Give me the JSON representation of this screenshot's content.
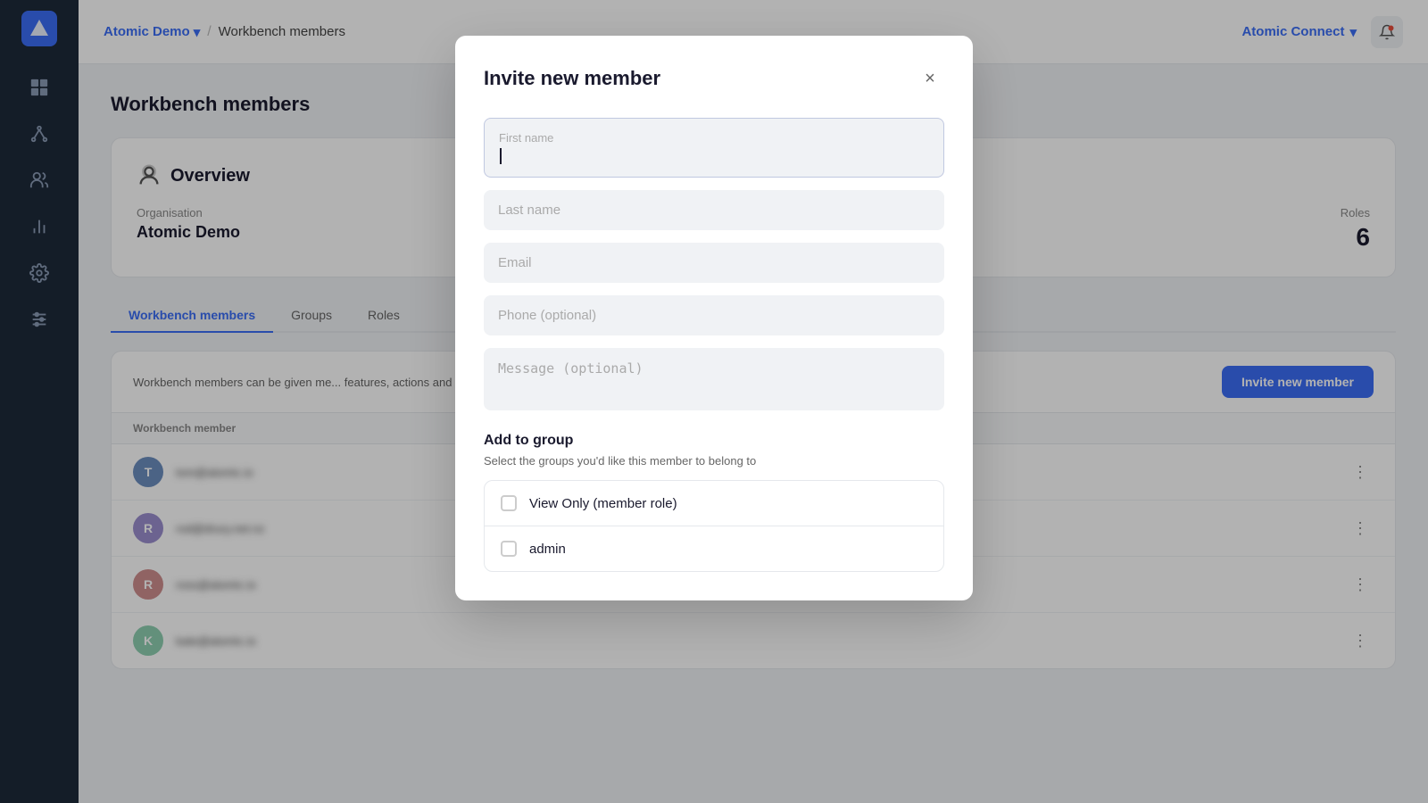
{
  "app": {
    "logo_letter": "A",
    "name": "Atomic Demo",
    "chevron": "▾",
    "breadcrumb_separator": "/",
    "page": "Workbench members",
    "connect": "Atomic Connect",
    "connect_chevron": "▾"
  },
  "sidebar": {
    "icons": [
      {
        "name": "layout-icon",
        "symbol": "▦"
      },
      {
        "name": "graph-icon",
        "symbol": "⑂"
      },
      {
        "name": "users-icon",
        "symbol": "👥"
      },
      {
        "name": "chart-icon",
        "symbol": "📊"
      },
      {
        "name": "settings-icon",
        "symbol": "⚙"
      },
      {
        "name": "sliders-icon",
        "symbol": "⚡"
      }
    ]
  },
  "page_title": "Workbench members",
  "overview": {
    "title": "Overview",
    "org_label": "Organisation",
    "org_value": "Atomic Demo",
    "roles_label": "Roles",
    "roles_value": "6"
  },
  "tabs": [
    {
      "label": "Workbench members",
      "active": true
    },
    {
      "label": "Groups",
      "active": false
    },
    {
      "label": "Roles",
      "active": false
    }
  ],
  "members": {
    "description": "Workbench members can be given me... features, actions and environments.",
    "description_full": "Workbench members can be given member access to specific features, actions and environments.",
    "invite_btn": "Invite new member",
    "col_header": "Workbench member",
    "rows": [
      {
        "initial": "T",
        "color": "#6c8ebf",
        "email": "tom@atomic.io"
      },
      {
        "initial": "R",
        "color": "#9b8ecf",
        "email": "rod@drury.net.nz"
      },
      {
        "initial": "R",
        "color": "#cf8e8e",
        "email": "ross@atomic.io"
      },
      {
        "initial": "K",
        "color": "#8ecfb0",
        "email": "kate@atomic.io"
      }
    ]
  },
  "modal": {
    "title": "Invite new member",
    "close_label": "×",
    "fields": {
      "first_name_placeholder": "First name",
      "last_name_placeholder": "Last name",
      "email_placeholder": "Email",
      "phone_placeholder": "Phone (optional)",
      "message_placeholder": "Message (optional)"
    },
    "add_group": {
      "title": "Add to group",
      "description": "Select the groups you'd like this member to belong to",
      "groups": [
        {
          "label": "View Only (member role)"
        },
        {
          "label": "admin"
        }
      ]
    }
  }
}
